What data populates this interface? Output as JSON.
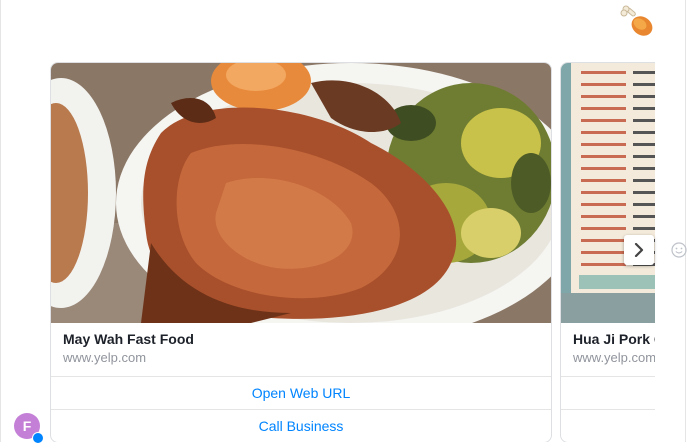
{
  "sticker": {
    "icon": "chicken-drumstick-icon"
  },
  "carousel": {
    "cards": [
      {
        "title": "May Wah Fast Food",
        "subtitle": "www.yelp.com",
        "image_icon": "pork-chop-rice-photo",
        "buttons": [
          {
            "label": "Open Web URL"
          },
          {
            "label": "Call Business"
          }
        ]
      },
      {
        "title": "Hua Ji Pork C",
        "subtitle": "www.yelp.com",
        "image_icon": "menu-board-photo",
        "buttons": [
          {
            "label": ""
          },
          {
            "label": ""
          }
        ]
      }
    ],
    "next_icon": "chevron-right-icon"
  },
  "composer": {
    "emoji_icon": "smiley-icon"
  },
  "user": {
    "avatar_initial": "F",
    "badge_icon": "messenger-badge-icon"
  },
  "colors": {
    "accent": "#0084ff",
    "avatar_bg": "#c480d6"
  }
}
